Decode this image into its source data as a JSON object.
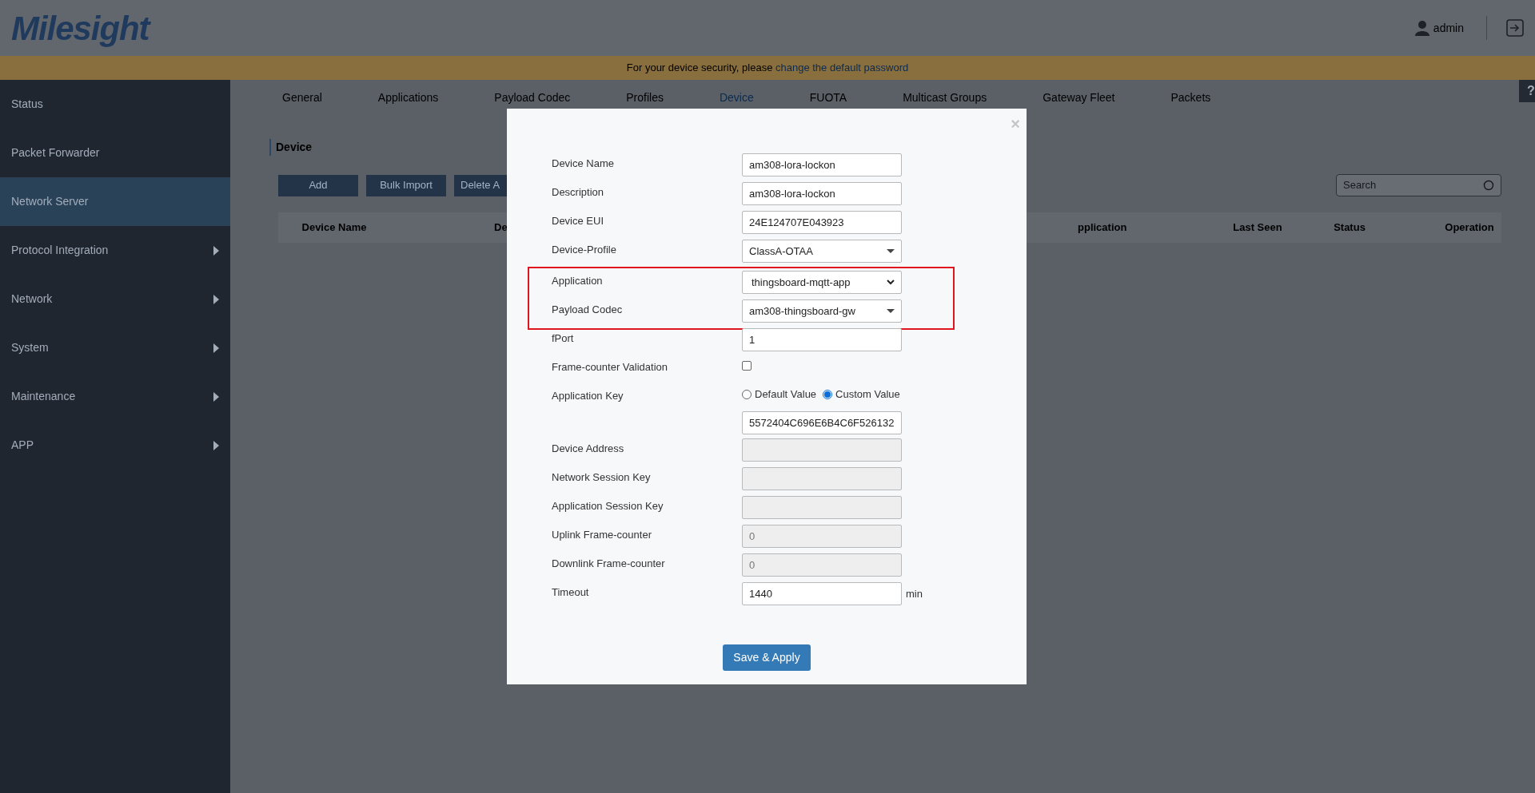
{
  "header": {
    "logo": "Milesight",
    "user": "admin"
  },
  "banner": {
    "text": "For your device security, please ",
    "link": "change the default password"
  },
  "sidebar": {
    "items": [
      {
        "label": "Status",
        "selected": false,
        "has_submenu": false
      },
      {
        "label": "Packet Forwarder",
        "selected": false,
        "has_submenu": false
      },
      {
        "label": "Network Server",
        "selected": true,
        "has_submenu": false
      },
      {
        "label": "Protocol Integration",
        "selected": false,
        "has_submenu": true
      },
      {
        "label": "Network",
        "selected": false,
        "has_submenu": true
      },
      {
        "label": "System",
        "selected": false,
        "has_submenu": true
      },
      {
        "label": "Maintenance",
        "selected": false,
        "has_submenu": true
      },
      {
        "label": "APP",
        "selected": false,
        "has_submenu": true
      }
    ]
  },
  "help": "?",
  "tabs": [
    {
      "label": "General",
      "selected": false
    },
    {
      "label": "Applications",
      "selected": false
    },
    {
      "label": "Payload Codec",
      "selected": false
    },
    {
      "label": "Profiles",
      "selected": false
    },
    {
      "label": "Device",
      "selected": true
    },
    {
      "label": "FUOTA",
      "selected": false
    },
    {
      "label": "Multicast Groups",
      "selected": false
    },
    {
      "label": "Gateway Fleet",
      "selected": false
    },
    {
      "label": "Packets",
      "selected": false
    }
  ],
  "section_title": "Device",
  "toolbar": {
    "buttons": [
      "Add",
      "Bulk Import",
      "Delete A"
    ],
    "search": {
      "placeholder": "Search"
    }
  },
  "table": {
    "columns": [
      "Device Name",
      "De",
      "pplication",
      "Last Seen",
      "Status",
      "Operation"
    ]
  },
  "dialog": {
    "close": "×",
    "fields": [
      {
        "kind": "text",
        "label": "Device Name",
        "value": "am308-lora-lockon",
        "disabled": false,
        "highlighted": false
      },
      {
        "kind": "text",
        "label": "Description",
        "value": "am308-lora-lockon",
        "disabled": false,
        "highlighted": false
      },
      {
        "kind": "text",
        "label": "Device EUI",
        "value": "24E124707E043923",
        "disabled": false,
        "highlighted": false
      },
      {
        "kind": "select",
        "label": "Device-Profile",
        "value": "ClassA-OTAA",
        "disabled": false,
        "highlighted": false
      },
      {
        "kind": "native-select",
        "label": "Application",
        "value": "thingsboard-mqtt-app",
        "disabled": false,
        "highlighted": true
      },
      {
        "kind": "select",
        "label": "Payload Codec",
        "value": "am308-thingsboard-gw",
        "disabled": false,
        "highlighted": true
      },
      {
        "kind": "text",
        "label": "fPort",
        "value": "1",
        "disabled": false,
        "highlighted": false
      },
      {
        "kind": "checkbox",
        "label": "Frame-counter Validation",
        "checked": false,
        "highlighted": false
      },
      {
        "kind": "radio",
        "label": "Application Key",
        "options": [
          {
            "label": "Default Value",
            "selected": false
          },
          {
            "label": "Custom Value",
            "selected": true
          }
        ],
        "value": "5572404C696E6B4C6F526132",
        "highlighted": false
      },
      {
        "kind": "text",
        "label": "Device Address",
        "disabled": true,
        "highlighted": false
      },
      {
        "kind": "text",
        "label": "Network Session Key",
        "disabled": true,
        "highlighted": false
      },
      {
        "kind": "text",
        "label": "Application Session Key",
        "disabled": true,
        "highlighted": false
      },
      {
        "kind": "text",
        "label": "Uplink Frame-counter",
        "value": "0",
        "disabled": true,
        "highlighted": false
      },
      {
        "kind": "text",
        "label": "Downlink Frame-counter",
        "value": "0",
        "disabled": true,
        "highlighted": false
      },
      {
        "kind": "text",
        "label": "Timeout",
        "value": "1440",
        "unit": "min",
        "disabled": false,
        "highlighted": false
      }
    ],
    "submit": "Save & Apply"
  }
}
